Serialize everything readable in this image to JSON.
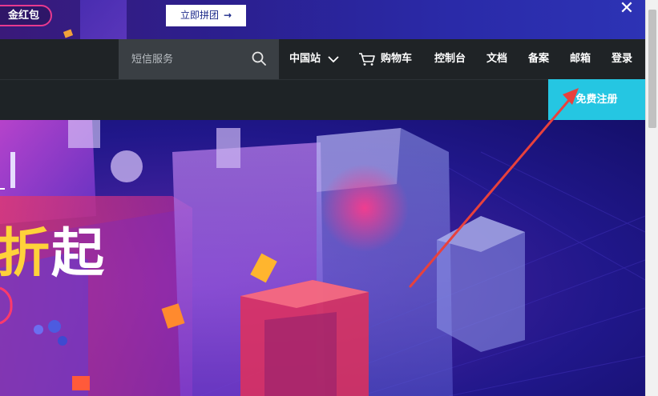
{
  "promo": {
    "pill_text": "金红包",
    "button_label": "立即拼团",
    "button_arrow": "→",
    "close_glyph": "✕"
  },
  "nav": {
    "search_placeholder": "短信服务",
    "region_label": "中国站",
    "cart_label": "购物车",
    "console_label": "控制台",
    "docs_label": "文档",
    "filing_label": "备案",
    "mail_label": "邮箱",
    "login_label": "登录",
    "icons": [
      "search-icon",
      "chevron-down-icon",
      "cart-icon"
    ]
  },
  "subbar": {
    "register_label": "免费注册"
  },
  "hero": {
    "headline_part1": "折",
    "headline_part2": "起"
  },
  "colors": {
    "register_bg": "#25c6e2",
    "nav_bg": "#1f2326",
    "promo_pill_border": "#e8398f",
    "annotation_arrow": "#e8413c"
  }
}
